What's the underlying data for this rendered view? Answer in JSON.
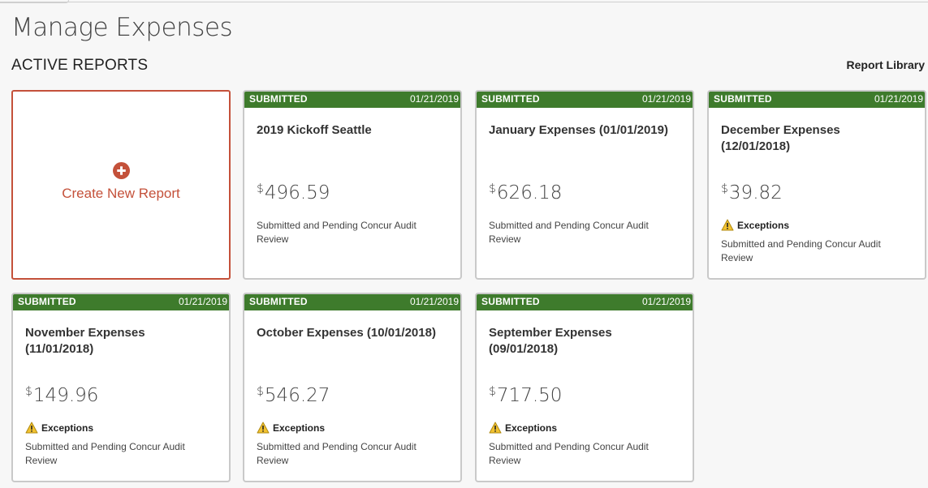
{
  "page": {
    "title": "Manage Expenses",
    "section_title": "ACTIVE REPORTS",
    "library_link": "Report Library"
  },
  "create_card": {
    "label": "Create New Report",
    "icon": "plus-circle-icon",
    "color": "#c4513a"
  },
  "colors": {
    "header_green": "#3e7b2c",
    "warning_yellow": "#f2c230"
  },
  "reports": [
    {
      "status": "SUBMITTED",
      "date": "01/21/2019",
      "name": "2019 Kickoff Seattle",
      "currency": "$",
      "amount": "496.59",
      "exceptions": "",
      "description": "Submitted and Pending Concur Audit Review"
    },
    {
      "status": "SUBMITTED",
      "date": "01/21/2019",
      "name": "January Expenses (01/01/2019)",
      "currency": "$",
      "amount": "626.18",
      "exceptions": "",
      "description": "Submitted and Pending Concur Audit Review"
    },
    {
      "status": "SUBMITTED",
      "date": "01/21/2019",
      "name": "December Expenses (12/01/2018)",
      "currency": "$",
      "amount": "39.82",
      "exceptions": "Exceptions",
      "description": "Submitted and Pending Concur Audit Review"
    },
    {
      "status": "SUBMITTED",
      "date": "01/21/2019",
      "name": "November Expenses (11/01/2018)",
      "currency": "$",
      "amount": "149.96",
      "exceptions": "Exceptions",
      "description": "Submitted and Pending Concur Audit Review"
    },
    {
      "status": "SUBMITTED",
      "date": "01/21/2019",
      "name": "October Expenses (10/01/2018)",
      "currency": "$",
      "amount": "546.27",
      "exceptions": "Exceptions",
      "description": "Submitted and Pending Concur Audit Review"
    },
    {
      "status": "SUBMITTED",
      "date": "01/21/2019",
      "name": "September Expenses (09/01/2018)",
      "currency": "$",
      "amount": "717.50",
      "exceptions": "Exceptions",
      "description": "Submitted and Pending Concur Audit Review"
    }
  ]
}
